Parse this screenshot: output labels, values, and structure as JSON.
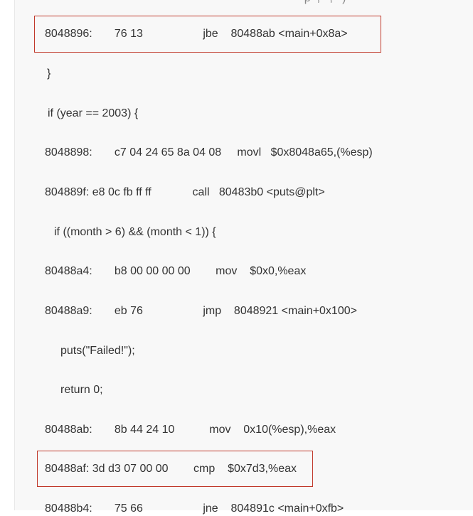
{
  "lines": [
    {
      "text": "                      p  ,   ,   )"
    },
    {
      "text": "8048896:       76 13                   jbe    80488ab <main+0x8a>"
    },
    {
      "text": "}"
    },
    {
      "text": "if (year == 2003) {"
    },
    {
      "text": "8048898:       c7 04 24 65 8a 04 08     movl   $0x8048a65,(%esp)"
    },
    {
      "text": "804889f: e8 0c fb ff ff             call   80483b0 <puts@plt>"
    },
    {
      "text": "if ((month > 6) && (month < 1)) {"
    },
    {
      "text": "80488a4:       b8 00 00 00 00        mov    $0x0,%eax"
    },
    {
      "text": "80488a9:       eb 76                   jmp    8048921 <main+0x100>"
    },
    {
      "text": "puts(\"Failed!\");"
    },
    {
      "text": "return 0;"
    },
    {
      "text": "80488ab:       8b 44 24 10           mov    0x10(%esp),%eax"
    },
    {
      "text": "80488af: 3d d3 07 00 00        cmp    $0x7d3,%eax"
    },
    {
      "text": "80488b4:       75 66                   jne    804891c <main+0xfb>"
    }
  ],
  "highlight_color": "#c0392b",
  "panel_color": "#f8f8f8"
}
